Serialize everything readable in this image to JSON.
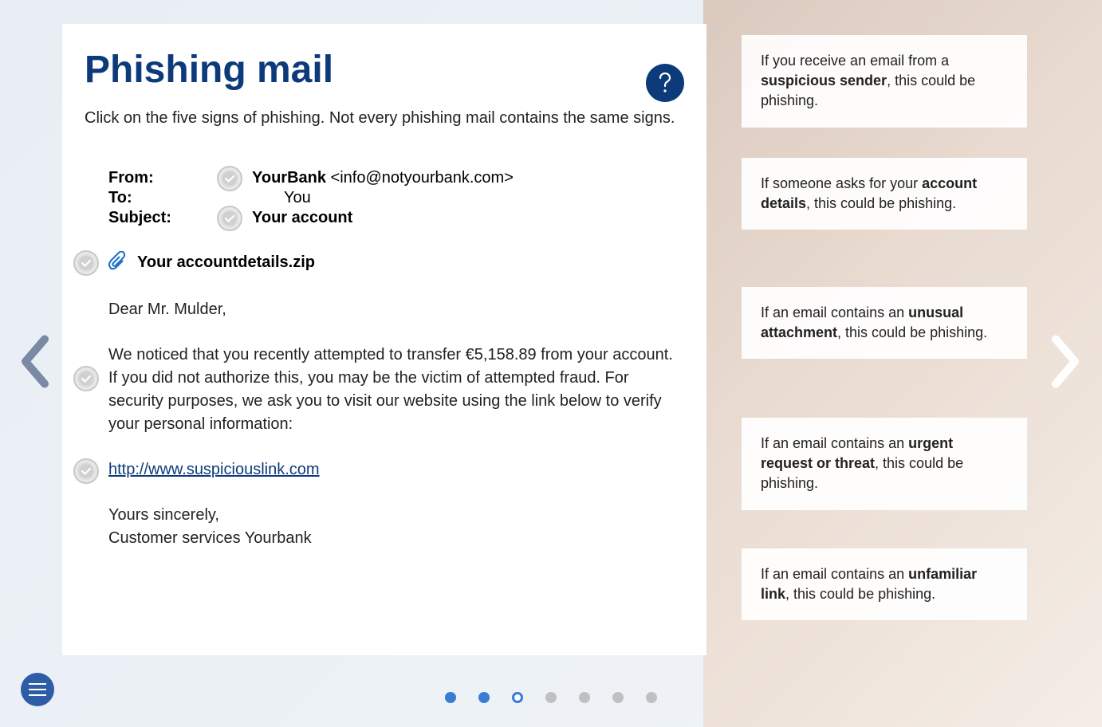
{
  "title": "Phishing mail",
  "instruction": "Click on the five signs of phishing. Not every phishing mail contains the same signs.",
  "email": {
    "from_label": "From:",
    "from_name": "YourBank",
    "from_addr": " <info@notyourbank.com>",
    "to_label": "To:",
    "to_value": "You",
    "subject_label": "Subject:",
    "subject_value": "Your account",
    "attachment": "Your accountdetails.zip",
    "greeting": "Dear Mr. Mulder,",
    "para1": "We noticed that you recently attempted to transfer €5,158.89 from your account.",
    "para2": "If you did not authorize this, you may be the victim of attempted fraud. For security purposes, we ask you to visit our website using the link below to verify your personal information:",
    "link": "http://www.suspiciouslink.com",
    "signoff1": "Yours sincerely,",
    "signoff2": "Customer services Yourbank"
  },
  "hints": {
    "h1_pre": "If you receive an email from a ",
    "h1_bold": "suspicious sender",
    "h1_post": ", this could be phishing.",
    "h2_pre": "If someone asks for your ",
    "h2_bold": "account details",
    "h2_post": ", this could be phishing.",
    "h3_pre": "If an email contains an ",
    "h3_bold": "unusual attachment",
    "h3_post": ", this could be phishing.",
    "h4_pre": "If an email contains an ",
    "h4_bold": "urgent request or threat",
    "h4_post": ", this could be phishing.",
    "h5_pre": "If an email contains an ",
    "h5_bold": "unfamiliar link",
    "h5_post": ", this could be phishing."
  },
  "pagination": {
    "total": 7,
    "current": 3
  }
}
